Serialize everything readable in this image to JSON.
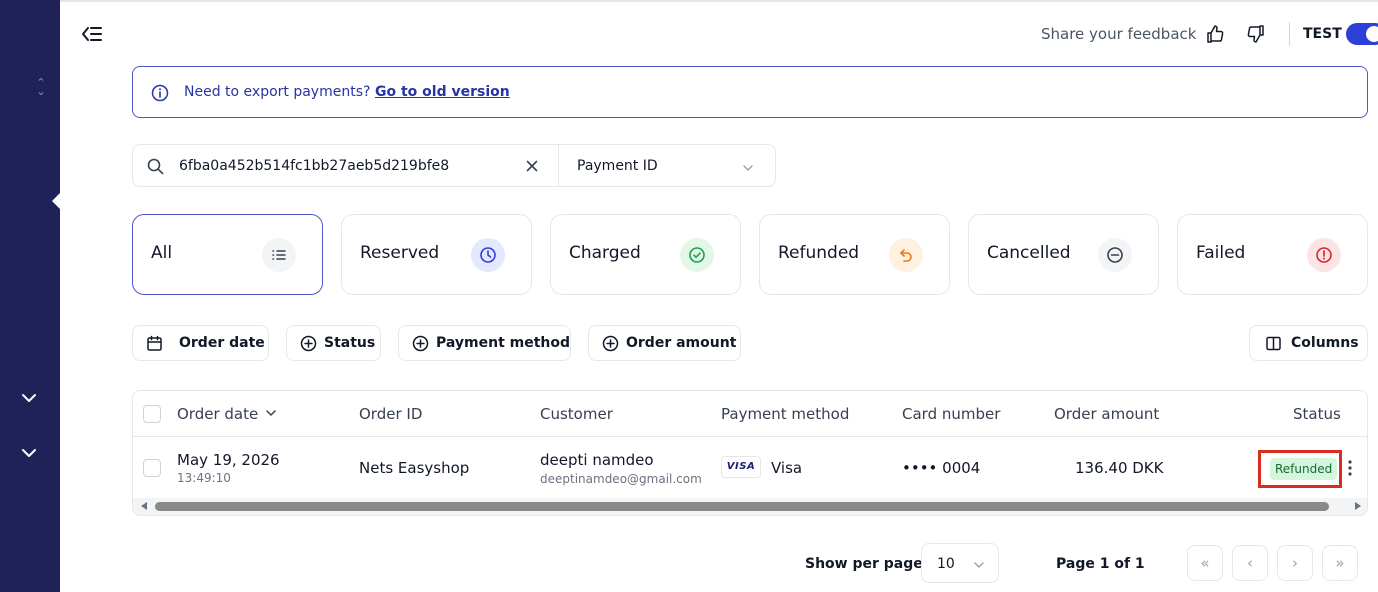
{
  "header": {
    "feedback_text": "Share your feedback",
    "mode_label": "TEST"
  },
  "banner": {
    "message": "Need to export payments?",
    "link": "Go to old version"
  },
  "search": {
    "value": "6fba0a452b514fc1bb27aeb5d219bfe8",
    "field": "Payment ID"
  },
  "status_tabs": [
    {
      "label": "All",
      "icon": "list-icon",
      "color": "#374151",
      "bg": "#f3f4f6"
    },
    {
      "label": "Reserved",
      "icon": "clock-icon",
      "color": "#2d3fd6",
      "bg": "#e3e8ff"
    },
    {
      "label": "Charged",
      "icon": "check-circle-icon",
      "color": "#16a34a",
      "bg": "#e3f7e8"
    },
    {
      "label": "Refunded",
      "icon": "refund-arrow-icon",
      "color": "#ea7a1a",
      "bg": "#fff1e0"
    },
    {
      "label": "Cancelled",
      "icon": "minus-circle-icon",
      "color": "#374151",
      "bg": "#f3f4f6"
    },
    {
      "label": "Failed",
      "icon": "alert-circle-icon",
      "color": "#dc2626",
      "bg": "#fde4e4"
    }
  ],
  "filters": {
    "order_date": "Order date",
    "status": "Status",
    "payment_method": "Payment method",
    "order_amount": "Order amount",
    "columns": "Columns"
  },
  "table": {
    "headers": {
      "order_date": "Order date",
      "order_id": "Order ID",
      "customer": "Customer",
      "payment_method": "Payment method",
      "card_number": "Card number",
      "order_amount": "Order amount",
      "status": "Status"
    },
    "rows": [
      {
        "date": "May 19, 2026",
        "time": "13:49:10",
        "order_id": "Nets Easyshop",
        "customer_name": "deepti namdeo",
        "customer_email": "deeptinamdeo@gmail.com",
        "card_brand": "VISA",
        "payment_method": "Visa",
        "card_number": "•••• 0004",
        "amount": "136.40 DKK",
        "status": "Refunded"
      }
    ]
  },
  "pagination": {
    "show_per_page_label": "Show per page",
    "per_page": "10",
    "page_info": "Page 1 of 1",
    "first": "«",
    "prev": "‹",
    "next": "›",
    "last": "»"
  }
}
